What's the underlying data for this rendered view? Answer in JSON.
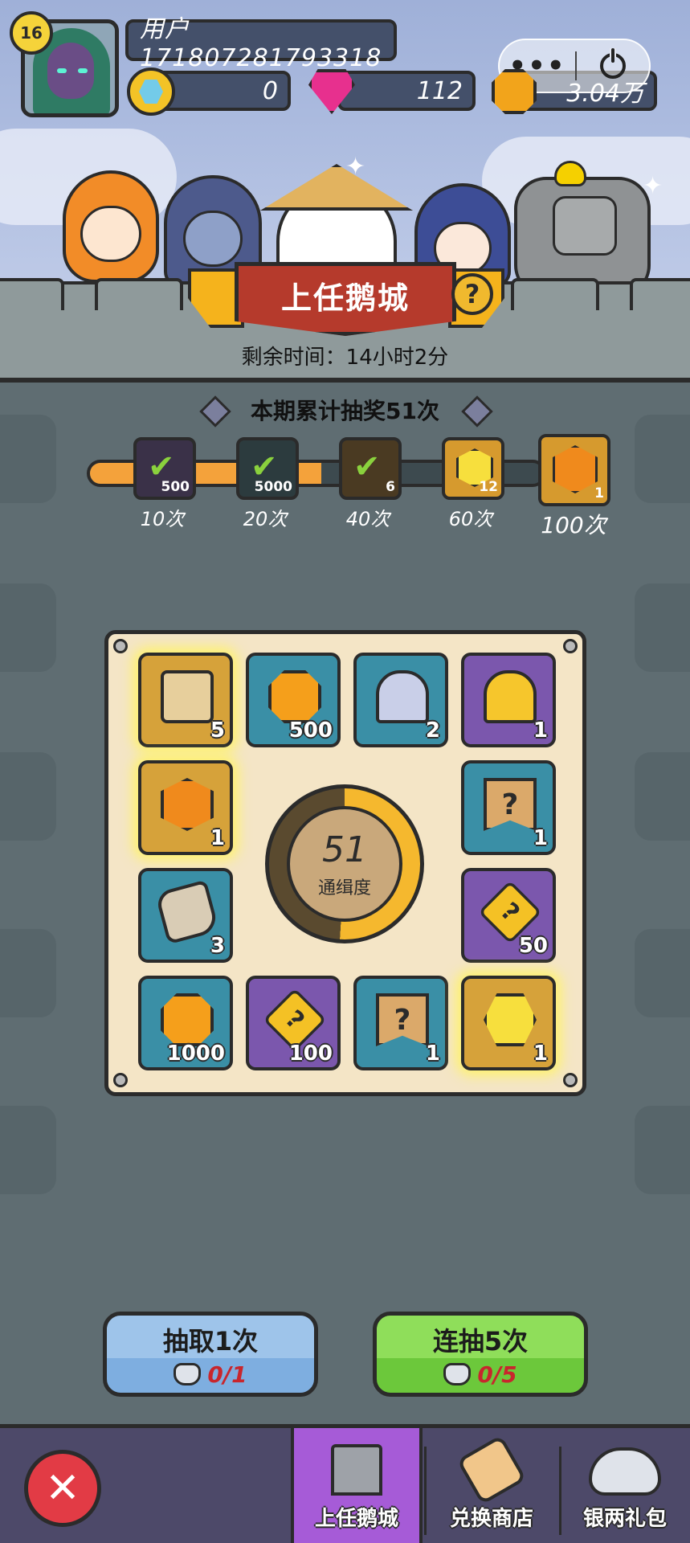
{
  "player": {
    "level": "16",
    "username": "用户171807281793318"
  },
  "resources": {
    "diamond": "0",
    "gem": "112",
    "gold": "3.04万"
  },
  "event": {
    "title": "上任鹅城",
    "remaining_time": "剩余时间：14小时2分",
    "total_draws": "本期累计抽奖51次",
    "progress_draws": 51,
    "progress_max": 100
  },
  "milestones": [
    {
      "count": "500",
      "label": "10次",
      "claimed": true,
      "color": "#3a3148"
    },
    {
      "count": "5000",
      "label": "20次",
      "claimed": true,
      "color": "#2c3b3e"
    },
    {
      "count": "6",
      "label": "40次",
      "claimed": true,
      "color": "#4a3a22"
    },
    {
      "count": "12",
      "label": "60次",
      "claimed": false,
      "color": "#d69a2e"
    },
    {
      "count": "1",
      "label": "100次",
      "claimed": false,
      "color": "#d69a2e"
    }
  ],
  "board": {
    "items": [
      {
        "icon": "scroll-icon",
        "qty": "5"
      },
      {
        "icon": "gold-coin-icon",
        "qty": "500"
      },
      {
        "icon": "silver-key-icon",
        "qty": "2"
      },
      {
        "icon": "gold-key-icon",
        "qty": "1"
      },
      {
        "icon": "orange-gem-icon",
        "qty": "1"
      },
      {
        "icon": "mystery-banner-icon",
        "qty": "1"
      },
      {
        "icon": "rune-stone-icon",
        "qty": "3"
      },
      {
        "icon": "mystery-puzzle-icon",
        "qty": "50"
      },
      {
        "icon": "gold-coin-icon",
        "qty": "1000"
      },
      {
        "icon": "mystery-puzzle-icon",
        "qty": "100"
      },
      {
        "icon": "mystery-banner-icon",
        "qty": "1"
      },
      {
        "icon": "yellow-gem-icon",
        "qty": "1"
      }
    ],
    "wanted_value": "51",
    "wanted_label": "通缉度",
    "wanted_fraction": 0.51
  },
  "actions": {
    "draw_one_label": "抽取1次",
    "draw_one_cost": "0/1",
    "draw_five_label": "连抽5次",
    "draw_five_cost": "0/5"
  },
  "nav": {
    "tab_event": "上任鹅城",
    "tab_shop": "兑换商店",
    "tab_pack": "银两礼包"
  },
  "capsule": {
    "more": "•••"
  }
}
